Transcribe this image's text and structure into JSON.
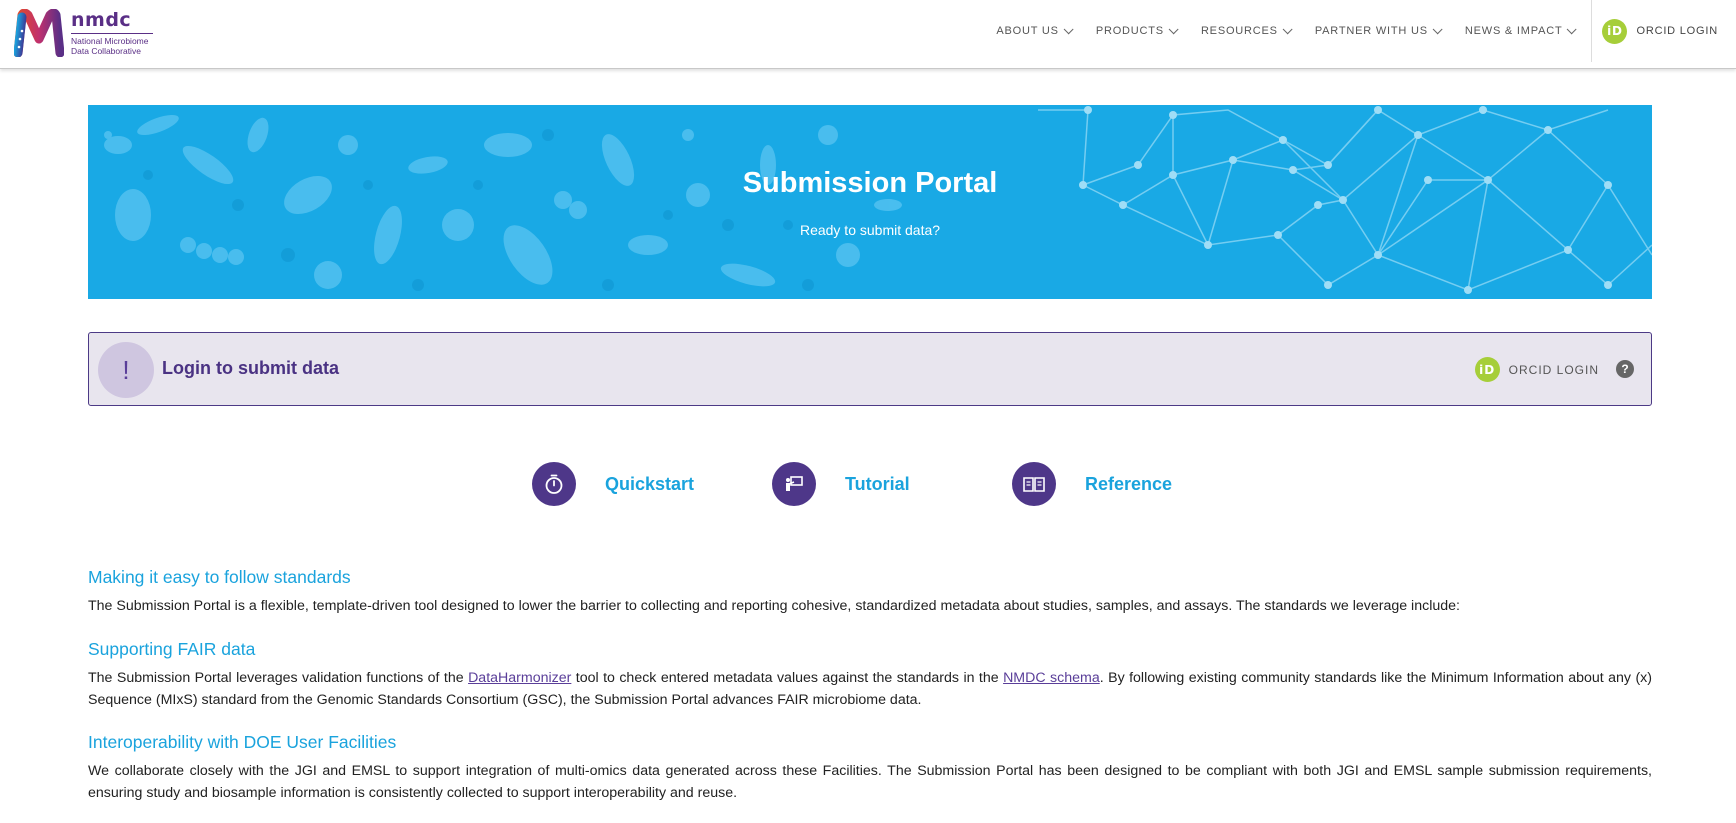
{
  "header": {
    "logo": {
      "word": "nmdc",
      "subtitle_line1": "National Microbiome",
      "subtitle_line2": "Data Collaborative"
    },
    "nav": [
      {
        "label": "ABOUT US"
      },
      {
        "label": "PRODUCTS"
      },
      {
        "label": "RESOURCES"
      },
      {
        "label": "PARTNER WITH US"
      },
      {
        "label": "NEWS & IMPACT"
      }
    ],
    "login_label": "ORCID LOGIN",
    "orcid_icon_text": "iD"
  },
  "banner": {
    "title": "Submission Portal",
    "subtitle": "Ready to submit data?"
  },
  "alert": {
    "icon_text": "!",
    "text": "Login to submit data",
    "login_label": "ORCID LOGIN",
    "orcid_icon_text": "iD",
    "help_text": "?"
  },
  "quick_links": [
    {
      "label": "Quickstart",
      "icon": "stopwatch-icon"
    },
    {
      "label": "Tutorial",
      "icon": "presenter-board-icon"
    },
    {
      "label": "Reference",
      "icon": "open-book-icon"
    }
  ],
  "sections": {
    "standards": {
      "title": "Making it easy to follow standards",
      "body": "The Submission Portal is a flexible, template-driven tool designed to lower the barrier to collecting and reporting cohesive, standardized metadata about studies, samples, and assays. The standards we leverage include:"
    },
    "fair": {
      "title": "Supporting FAIR data",
      "part1": "The Submission Portal leverages validation functions of the ",
      "link1": "DataHarmonizer",
      "part2": " tool to check entered metadata values against the standards in the ",
      "link2": "NMDC schema",
      "part3": ". By following existing community standards like the Minimum Information about any (x) Sequence (MIxS) standard from the Genomic Standards Consortium (GSC), the Submission Portal advances FAIR microbiome data."
    },
    "doe": {
      "title": "Interoperability with DOE User Facilities",
      "body": "We collaborate closely with the JGI and EMSL to support integration of multi-omics data generated across these Facilities. The Submission Portal has been designed to be compliant with both JGI and EMSL sample submission requirements, ensuring study and biosample information is consistently collected to support interoperability and reuse."
    }
  },
  "colors": {
    "brand_purple": "#4e3789",
    "accent_blue": "#1aa3dd",
    "banner_blue": "#19a9e5",
    "orcid_green": "#a6ce39"
  }
}
